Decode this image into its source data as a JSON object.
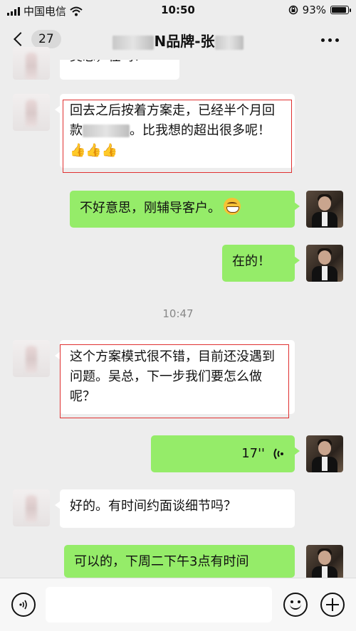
{
  "status_bar": {
    "carrier": "中国电信",
    "time": "10:50",
    "battery_percent": "93%",
    "battery_level": 0.93
  },
  "nav": {
    "back_count": "27",
    "title_prefix": "N品牌-张",
    "more_icon": "more-dots-icon"
  },
  "messages": [
    {
      "from": "them",
      "text": "吴总，在吗？"
    },
    {
      "from": "them",
      "text_before": "回去之后按着方案走，已经半个月回款",
      "text_after": "。比我想的超出很多呢！",
      "emoji": "👍👍👍"
    },
    {
      "from": "me",
      "text": "不好意思，刚辅导客户。"
    },
    {
      "from": "me",
      "text": "在的！"
    },
    {
      "from": "them",
      "text": "这个方案模式很不错，目前还没遇到问题。吴总，下一步我们要怎么做呢？"
    },
    {
      "from": "me",
      "voice_duration": "17''"
    },
    {
      "from": "them",
      "text": "好的。有时间约面谈细节吗？"
    },
    {
      "from": "me",
      "text": "可以的，下周二下午3点有时间"
    }
  ],
  "timestamp": "10:47",
  "input": {
    "placeholder": "",
    "voice_icon": "voice-icon",
    "emoji_icon": "emoji-icon",
    "plus_icon": "plus-icon"
  },
  "colors": {
    "background": "#ededed",
    "my_bubble": "#95ec69",
    "their_bubble": "#ffffff",
    "highlight_box": "#e03030"
  }
}
